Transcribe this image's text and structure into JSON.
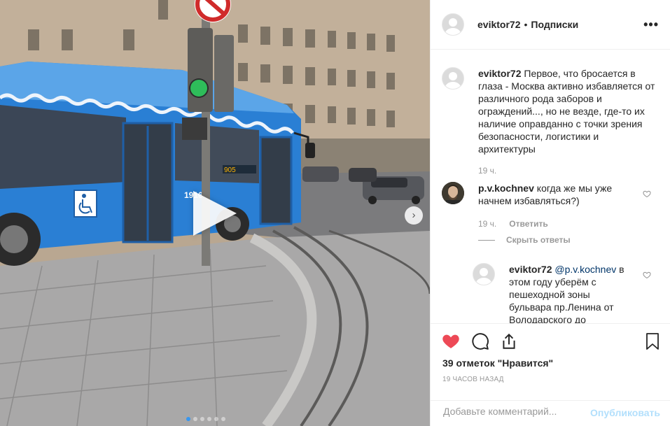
{
  "header": {
    "username": "eviktor72",
    "separator": "•",
    "follow_label": "Подписки",
    "more_icon": "more-horizontal-icon",
    "more_glyph": "•••"
  },
  "caption": {
    "username": "eviktor72",
    "text": "Первое, что бросается в глаза - Москва активно избавляется от различного рода заборов и ограждений..., но не везде, где-то их наличие оправданно с точки зрения безопасности, логистики и архитектуры",
    "time": "19 ч."
  },
  "comments": [
    {
      "username": "p.v.kochnev",
      "text": "когда же мы уже начнем избавляться?)",
      "time": "19 ч.",
      "reply_label": "Ответить",
      "hide_replies_label": "Скрыть ответы"
    }
  ],
  "reply": {
    "username": "eviktor72",
    "mention": "@p.v.kochnev",
    "text": "в этом году уберём с пешеходной зоны бульвара пр.Ленина от Володарского до"
  },
  "actions": {
    "like_icon": "heart-filled-icon",
    "comment_icon": "comment-icon",
    "share_icon": "share-icon",
    "save_icon": "bookmark-icon"
  },
  "likes": {
    "count": "39",
    "label_prefix": "отметок",
    "label_quote": "\"Нравится\""
  },
  "posted_ago": "19 ЧАСОВ НАЗАД",
  "add_comment": {
    "placeholder": "Добавьте комментарий...",
    "publish_label": "Опубликовать"
  },
  "media": {
    "play_icon": "play-icon",
    "next_icon": "chevron-right-icon",
    "next_glyph": "›",
    "carousel_count": 6,
    "carousel_active": 0,
    "bus_route": "905",
    "bus_number": "1916"
  },
  "colors": {
    "like_red": "#ed4956",
    "link_blue": "#003569",
    "publish_disabled": "#b2dffc",
    "carousel_active": "#3897f0",
    "bus_blue": "#2a7fd4"
  }
}
